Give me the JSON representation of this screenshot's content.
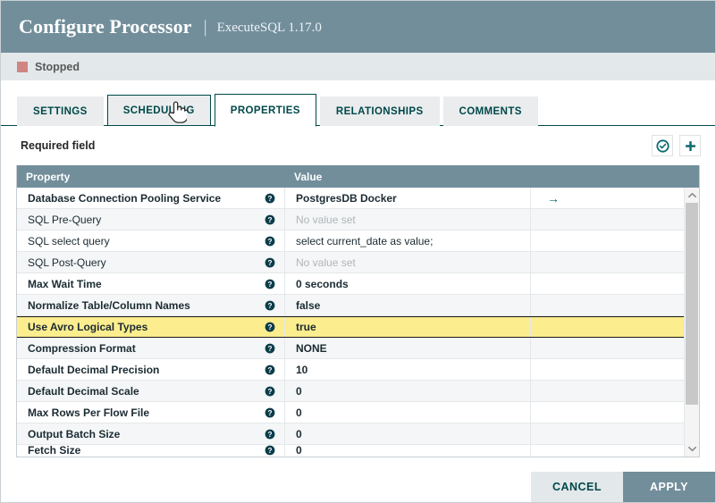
{
  "window": {
    "title": "Configure Processor",
    "separator": "|",
    "subtitle": "ExecuteSQL 1.17.0"
  },
  "status": {
    "label": "Stopped",
    "color": "#d18582"
  },
  "tabs": [
    {
      "label": "SETTINGS",
      "state": "normal"
    },
    {
      "label": "SCHEDULING",
      "state": "hover"
    },
    {
      "label": "PROPERTIES",
      "state": "active"
    },
    {
      "label": "RELATIONSHIPS",
      "state": "normal"
    },
    {
      "label": "COMMENTS",
      "state": "normal"
    }
  ],
  "toolbar": {
    "required_field_label": "Required field",
    "verify_icon": "circled-check-icon",
    "add_icon": "plus-icon"
  },
  "table": {
    "columns": [
      "Property",
      "Value"
    ],
    "help_icon": "help-circle-icon",
    "goto_icon": "arrow-right-icon",
    "empty_value_text": "No value set",
    "rows": [
      {
        "property": "Database Connection Pooling Service",
        "value": "PostgresDB Docker",
        "required": true,
        "empty": false,
        "selected": false,
        "extra": "→"
      },
      {
        "property": "SQL Pre-Query",
        "value": "No value set",
        "required": false,
        "empty": true,
        "selected": false,
        "extra": ""
      },
      {
        "property": "SQL select query",
        "value": "select current_date as value;",
        "required": false,
        "empty": false,
        "selected": false,
        "extra": ""
      },
      {
        "property": "SQL Post-Query",
        "value": "No value set",
        "required": false,
        "empty": true,
        "selected": false,
        "extra": ""
      },
      {
        "property": "Max Wait Time",
        "value": "0 seconds",
        "required": true,
        "empty": false,
        "selected": false,
        "extra": ""
      },
      {
        "property": "Normalize Table/Column Names",
        "value": "false",
        "required": true,
        "empty": false,
        "selected": false,
        "extra": ""
      },
      {
        "property": "Use Avro Logical Types",
        "value": "true",
        "required": true,
        "empty": false,
        "selected": true,
        "extra": ""
      },
      {
        "property": "Compression Format",
        "value": "NONE",
        "required": true,
        "empty": false,
        "selected": false,
        "extra": ""
      },
      {
        "property": "Default Decimal Precision",
        "value": "10",
        "required": true,
        "empty": false,
        "selected": false,
        "extra": ""
      },
      {
        "property": "Default Decimal Scale",
        "value": "0",
        "required": true,
        "empty": false,
        "selected": false,
        "extra": ""
      },
      {
        "property": "Max Rows Per Flow File",
        "value": "0",
        "required": true,
        "empty": false,
        "selected": false,
        "extra": ""
      },
      {
        "property": "Output Batch Size",
        "value": "0",
        "required": true,
        "empty": false,
        "selected": false,
        "extra": ""
      },
      {
        "property": "Fetch Size",
        "value": "0",
        "required": true,
        "empty": false,
        "selected": false,
        "extra": ""
      }
    ]
  },
  "scrollbar": {
    "up_icon": "chevron-up-icon",
    "down_icon": "chevron-down-icon"
  },
  "footer": {
    "cancel_label": "CANCEL",
    "apply_label": "APPLY"
  },
  "colors": {
    "header_bar": "#728e9b",
    "accent": "#004849",
    "selected_row": "#fced8e",
    "status": "#d18582"
  }
}
